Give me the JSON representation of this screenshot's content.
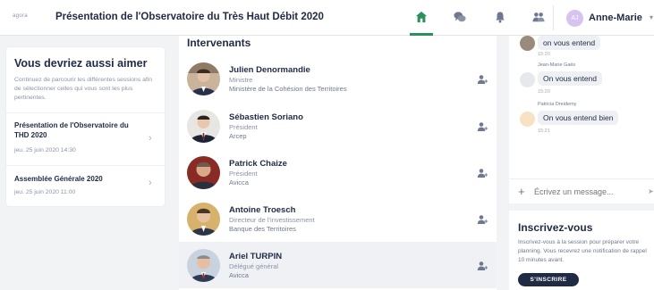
{
  "header": {
    "logo_text": "agora",
    "event_title": "Présentation de l'Observatoire du Très Haut Débit 2020",
    "nav": [
      {
        "icon": "home-icon",
        "active": true
      },
      {
        "icon": "chat-icon",
        "active": false
      },
      {
        "icon": "bell-icon",
        "active": false
      },
      {
        "icon": "people-icon",
        "active": false
      }
    ],
    "user": {
      "initials": "AJ",
      "name": "Anne-Marie"
    },
    "accent": "#2f8f5b"
  },
  "suggestions": {
    "title": "Vous devriez aussi aimer",
    "description": "Continuez de parcourir les différentes sessions afin de sélectionner celles qui vous sont les plus pertinentes.",
    "sessions": [
      {
        "title": "Présentation de l'Observatoire du THD 2020",
        "date": "jeu. 25 juin 2020 14:30"
      },
      {
        "title": "Assemblée Générale 2020",
        "date": "jeu. 25 juin 2020 11:00"
      }
    ]
  },
  "speakers": {
    "title": "Intervenants",
    "items": [
      {
        "name": "Julien Denormandie",
        "role": "Ministre",
        "org": "Ministère de la Cohésion des Territoires"
      },
      {
        "name": "Sébastien Soriano",
        "role": "Président",
        "org": "Arcep"
      },
      {
        "name": "Patrick Chaize",
        "role": "Président",
        "org": "Avicca"
      },
      {
        "name": "Antoine Troesch",
        "role": "Directeur de l'investissement",
        "org": "Banque des Territoires"
      },
      {
        "name": "Ariel TURPIN",
        "role": "Délégué général",
        "org": "Avicca"
      }
    ]
  },
  "chat": {
    "messages": [
      {
        "author": "",
        "text": "on vous entend",
        "time": "15:20"
      },
      {
        "author": "Jean-Marie Gaës",
        "text": "On vous entend",
        "time": "15:20"
      },
      {
        "author": "Patricia Dreidemy",
        "text": "On vous entend bien",
        "time": "15:21"
      }
    ],
    "input_placeholder": "Écrivez un message..."
  },
  "register": {
    "title": "Inscrivez-vous",
    "description": "Inscrivez-vous à la session pour préparer votre planning. Vous recevrez une notification de rappel 10 minutes avant.",
    "button_label": "S'INSCRIRE"
  }
}
